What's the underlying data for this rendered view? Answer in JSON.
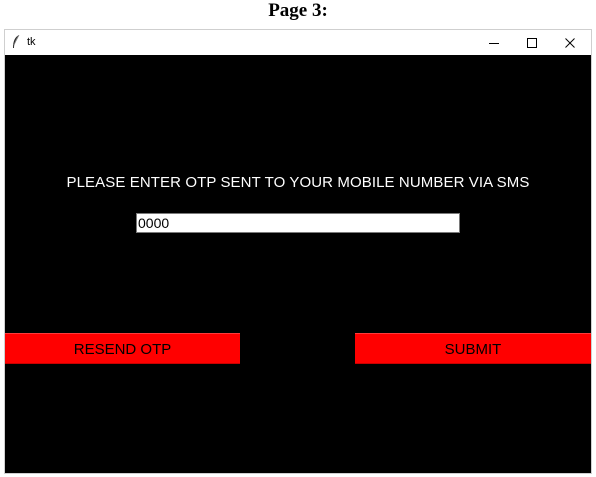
{
  "doc_caption": "Page 3:",
  "window": {
    "title": "tk",
    "controls": {
      "minimize_icon": "minimize-icon",
      "maximize_icon": "maximize-icon",
      "close_icon": "close-icon"
    }
  },
  "form": {
    "prompt": "PLEASE ENTER OTP SENT TO YOUR MOBILE NUMBER VIA SMS",
    "otp_value": "0000",
    "resend_label": "RESEND OTP",
    "submit_label": "SUBMIT"
  },
  "colors": {
    "window_background": "#000000",
    "button_background": "#ff0000",
    "prompt_text": "#ffffff"
  }
}
